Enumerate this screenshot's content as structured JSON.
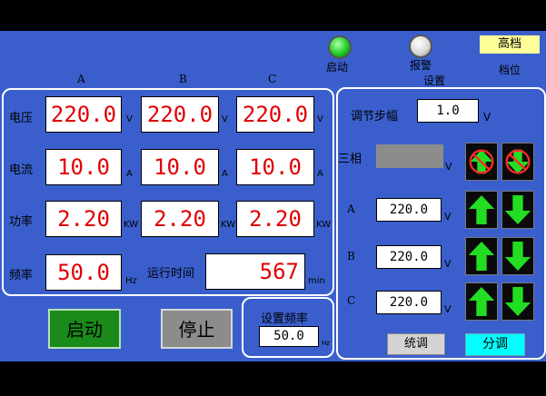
{
  "status": {
    "run_lamp_label": "启动",
    "alarm_lamp_label": "报警",
    "gear_value": "高档",
    "gear_label": "档位",
    "settings_title": "设置",
    "colors": {
      "run_lamp": "#22cc22",
      "alarm_lamp": "#d9d9d9",
      "gear_bg": "#ffff99"
    }
  },
  "measurements": {
    "phase_headers": [
      "A",
      "B",
      "C"
    ],
    "voltage": {
      "label": "电压",
      "unit": "V",
      "values": [
        "220.0",
        "220.0",
        "220.0"
      ]
    },
    "current": {
      "label": "电流",
      "unit": "A",
      "values": [
        "10.0",
        "10.0",
        "10.0"
      ]
    },
    "power": {
      "label": "功率",
      "unit": "KW",
      "values": [
        "2.20",
        "2.20",
        "2.20"
      ]
    },
    "frequency": {
      "label": "频率",
      "value": "50.0",
      "unit": "Hz"
    },
    "runtime": {
      "label": "运行时间",
      "value": "567",
      "unit": "min"
    }
  },
  "controls": {
    "start_label": "启动",
    "stop_label": "停止",
    "freq_setting": {
      "label": "设置频率",
      "value": "50.0",
      "unit": "Hz"
    }
  },
  "settings": {
    "step": {
      "label": "调节步幅",
      "value": "1.0",
      "unit": "V"
    },
    "three_phase": {
      "label": "三相",
      "value": "",
      "unit": "V"
    },
    "phases": [
      {
        "label": "A",
        "value": "220.0",
        "unit": "V"
      },
      {
        "label": "B",
        "value": "220.0",
        "unit": "V"
      },
      {
        "label": "C",
        "value": "220.0",
        "unit": "V"
      }
    ],
    "unified_label": "统调",
    "split_label": "分调",
    "colors": {
      "arrow_green": "#22dd22",
      "disabled_red": "#ff2a2a",
      "split_bg": "#00ffff",
      "unified_bg": "#d4d4d4"
    }
  }
}
